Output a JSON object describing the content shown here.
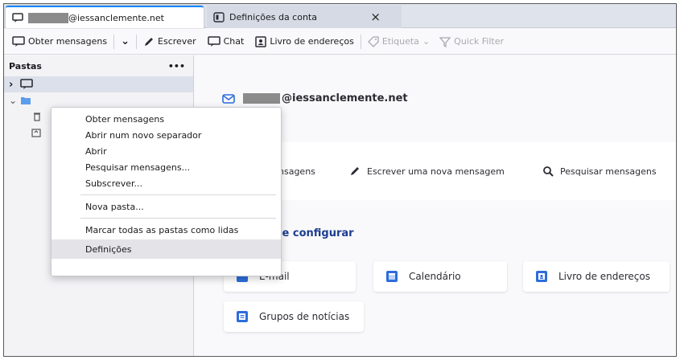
{
  "tabs": [
    {
      "label_suffix": "@iessanclemente.net",
      "active": true
    },
    {
      "label": "Definições da conta",
      "close": "×"
    }
  ],
  "toolbar": {
    "get_messages": "Obter mensagens",
    "dropdown": "⌄",
    "write": "Escrever",
    "chat": "Chat",
    "address_book": "Livro de endereços",
    "tag": "Etiqueta",
    "tag_dropdown": "⌄",
    "quick_filter": "Quick Filter"
  },
  "folder_pane": {
    "header": "Pastas",
    "more": "•••",
    "expand_collapsed": "›",
    "expand_open": "⌄"
  },
  "account": {
    "email_suffix": "@iessanclemente.net"
  },
  "actions": {
    "read_partial": "nsagens",
    "write_new": "Escrever uma nova mensagem",
    "search": "Pesquisar mensagens"
  },
  "setup": {
    "title_partial": "que configurar",
    "cards": {
      "email_partial": "E-mail",
      "calendar": "Calendário",
      "address_book": "Livro de endereços",
      "newsgroups": "Grupos de notícias"
    }
  },
  "context_menu": {
    "items": [
      {
        "label": "Obter mensagens"
      },
      {
        "label": "Abrir num novo separador"
      },
      {
        "label": "Abrir"
      },
      {
        "label": "Pesquisar mensagens..."
      },
      {
        "label": "Subscrever..."
      },
      {
        "label": "Nova pasta..."
      },
      {
        "label": "Marcar todas as pastas como lidas"
      },
      {
        "label": "Definições"
      }
    ]
  },
  "colors": {
    "accent": "#0a84ff",
    "setup_title": "#1d3d8f",
    "icon_blue": "#2d6ddb"
  }
}
